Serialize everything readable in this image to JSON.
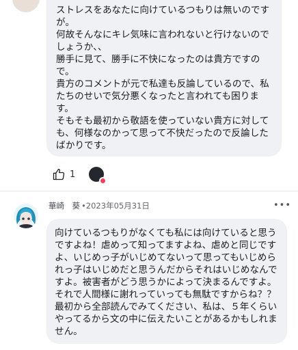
{
  "comment_1": {
    "text": "ストレスをあなたに向けているつもりは無いのですが。\n何故そんなにキレ気味に言われないと行けないのでしょうか、、\n勝手に見て、勝手に不快になったのは貴方ですので。\n貴方のコメントが元で私達も反論しているので、私たちのせいで気分悪くなったと言われても困ります。\nそもそも最初から敬語を使っていない貴方に対しても、何様なのかって思って不快だったので反論したばかりです。",
    "like_count": "1"
  },
  "comment_2": {
    "author": "華崎　葵",
    "separator": "•",
    "date": "2023年05月31日",
    "more": "•••",
    "text": "向けているつもりがなくても私には向けていると思うですよね！虐めって知ってますよね、虐めと同じですよ、いじめっ子がいじめてないって思ってもいじめられっ子はいじめだと思うんだからそれはいじめなんですよ。被害者がどう思うかによって決まるんですよ。それで人間様に謝れっていっても無駄ですからね？？最初から全部読んでみてください、私は、５年くらいやってるから文の中に伝えたいことがあるかもしれません。"
  },
  "colors": {
    "bubble": "#eff1f4",
    "meta": "#65676b",
    "heart": "#ff3b5c"
  },
  "icons": {
    "like": "thumbs-up-icon",
    "reaction": "heart-icon"
  }
}
